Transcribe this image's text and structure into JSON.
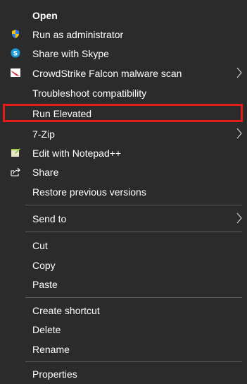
{
  "menu": {
    "items": [
      {
        "label": "Open"
      },
      {
        "label": "Run as administrator"
      },
      {
        "label": "Share with Skype"
      },
      {
        "label": "CrowdStrike Falcon malware scan"
      },
      {
        "label": "Troubleshoot compatibility"
      },
      {
        "label": "Run Elevated"
      },
      {
        "label": "7-Zip"
      },
      {
        "label": "Edit with Notepad++"
      },
      {
        "label": "Share"
      },
      {
        "label": "Restore previous versions"
      },
      {
        "label": "Send to"
      },
      {
        "label": "Cut"
      },
      {
        "label": "Copy"
      },
      {
        "label": "Paste"
      },
      {
        "label": "Create shortcut"
      },
      {
        "label": "Delete"
      },
      {
        "label": "Rename"
      },
      {
        "label": "Properties"
      }
    ]
  },
  "icons": {
    "admin": "uac-shield-icon",
    "skype": "skype-icon",
    "crowdstrike": "crowdstrike-icon",
    "notepadpp": "notepad-plus-plus-icon",
    "share": "share-icon",
    "submenu": "chevron-right-icon"
  },
  "colors": {
    "background": "#2b2b2b",
    "text": "#ffffff",
    "separator": "#5a5a5a",
    "highlight_border": "#e21b1b"
  }
}
